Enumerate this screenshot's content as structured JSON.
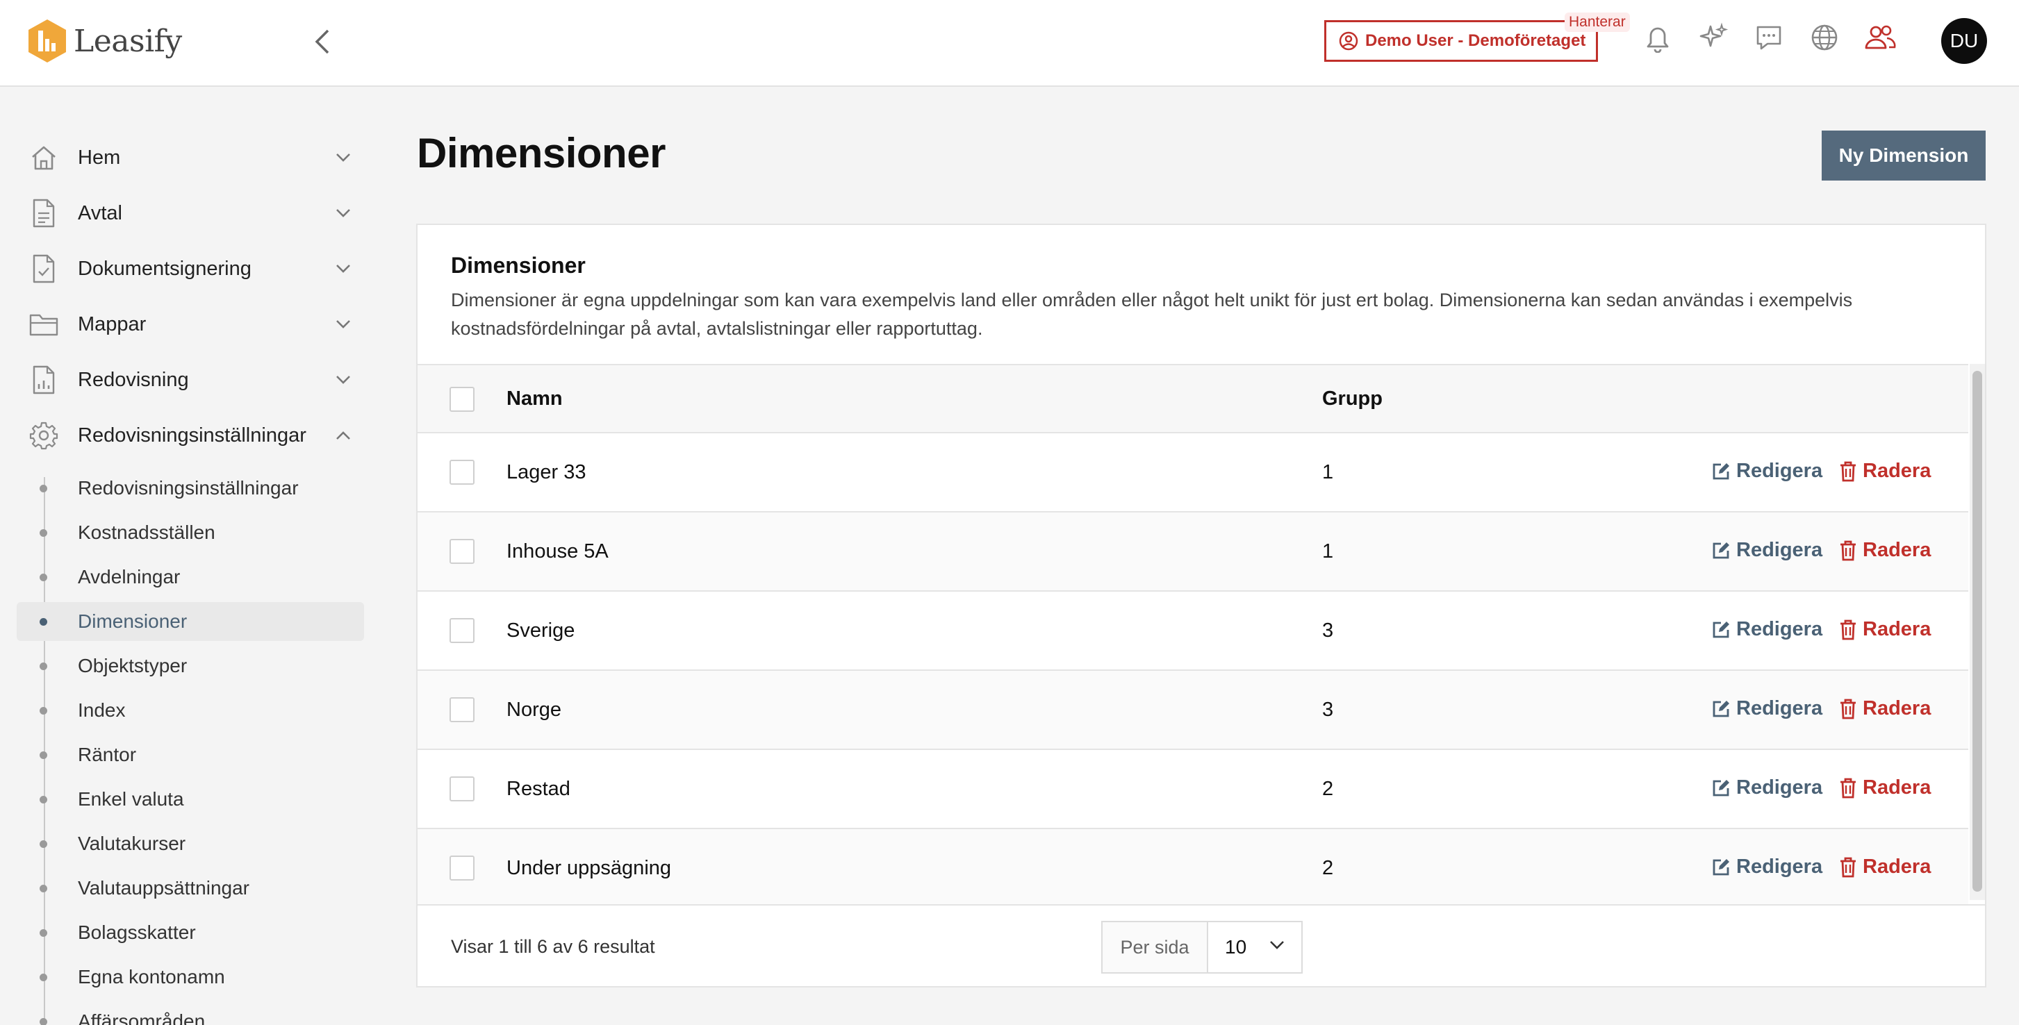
{
  "app": {
    "name": "Leasify",
    "managing_label": "Demo User - Demoföretaget",
    "managing_badge": "Hanterar",
    "avatar_initials": "DU",
    "accent_color": "#c0302b",
    "brand_color": "#556a7d",
    "logo_color": "#f0a73a"
  },
  "topbar": {
    "icons": [
      "bell-icon",
      "sparkles-icon",
      "chat-icon",
      "globe-icon",
      "users-icon"
    ]
  },
  "sidebar": {
    "items": [
      {
        "label": "Hem",
        "icon": "home-icon",
        "expanded": false
      },
      {
        "label": "Avtal",
        "icon": "document-icon",
        "expanded": false
      },
      {
        "label": "Dokumentsignering",
        "icon": "document-check-icon",
        "expanded": false
      },
      {
        "label": "Mappar",
        "icon": "folder-icon",
        "expanded": false
      },
      {
        "label": "Redovisning",
        "icon": "report-icon",
        "expanded": false
      },
      {
        "label": "Redovisningsinställningar",
        "icon": "gear-icon",
        "expanded": true
      }
    ],
    "sub_items": [
      "Redovisningsinställningar",
      "Kostnadsställen",
      "Avdelningar",
      "Dimensioner",
      "Objektstyper",
      "Index",
      "Räntor",
      "Enkel valuta",
      "Valutakurser",
      "Valutauppsättningar",
      "Bolagsskatter",
      "Egna kontonamn",
      "Affärsområden"
    ],
    "active_sub_item": "Dimensioner"
  },
  "page": {
    "title": "Dimensioner",
    "new_button": "Ny Dimension"
  },
  "card": {
    "title": "Dimensioner",
    "description": "Dimensioner är egna uppdelningar som kan vara exempelvis land eller områden eller något helt unikt för just ert bolag. Dimensionerna kan sedan användas i exempelvis kostnadsfördelningar på avtal, avtalslistningar eller rapportuttag."
  },
  "table": {
    "columns": {
      "name": "Namn",
      "group": "Grupp"
    },
    "rows": [
      {
        "name": "Lager 33",
        "group": "1"
      },
      {
        "name": "Inhouse 5A",
        "group": "1"
      },
      {
        "name": "Sverige",
        "group": "3"
      },
      {
        "name": "Norge",
        "group": "3"
      },
      {
        "name": "Restad",
        "group": "2"
      },
      {
        "name": "Under uppsägning",
        "group": "2"
      }
    ],
    "edit_label": "Redigera",
    "delete_label": "Radera"
  },
  "pagination": {
    "summary": "Visar 1 till 6 av 6 resultat",
    "per_page_label": "Per sida",
    "per_page_value": "10"
  }
}
